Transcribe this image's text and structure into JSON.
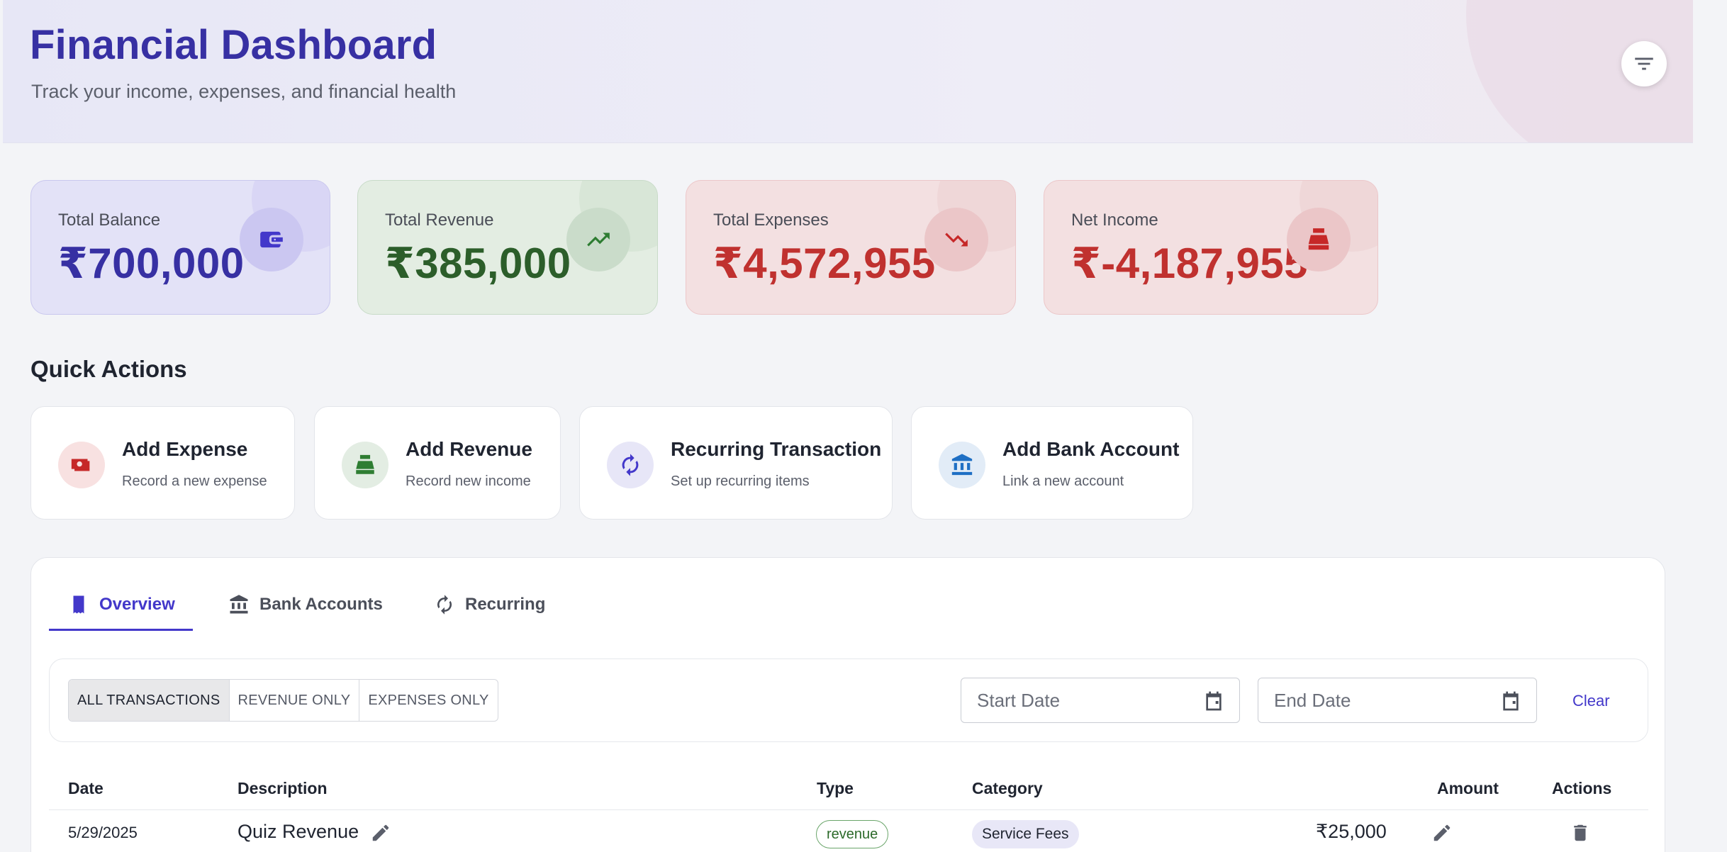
{
  "header": {
    "title": "Financial Dashboard",
    "subtitle": "Track your income, expenses, and financial health"
  },
  "stats": {
    "balance": {
      "label": "Total Balance",
      "value": "₹700,000"
    },
    "revenue": {
      "label": "Total Revenue",
      "value": "₹385,000"
    },
    "expenses": {
      "label": "Total Expenses",
      "value": "₹4,572,955"
    },
    "net": {
      "label": "Net Income",
      "value": "₹-4,187,955"
    }
  },
  "quick_actions": {
    "title": "Quick Actions",
    "items": [
      {
        "title": "Add Expense",
        "subtitle": "Record a new expense"
      },
      {
        "title": "Add Revenue",
        "subtitle": "Record new income"
      },
      {
        "title": "Recurring Transaction",
        "subtitle": "Set up recurring items"
      },
      {
        "title": "Add Bank Account",
        "subtitle": "Link a new account"
      }
    ]
  },
  "tabs": [
    {
      "label": "Overview",
      "active": true
    },
    {
      "label": "Bank Accounts",
      "active": false
    },
    {
      "label": "Recurring",
      "active": false
    }
  ],
  "filters": {
    "segments": [
      "ALL TRANSACTIONS",
      "REVENUE ONLY",
      "EXPENSES ONLY"
    ],
    "active_segment": "ALL TRANSACTIONS",
    "start_date_placeholder": "Start Date",
    "end_date_placeholder": "End Date",
    "clear_label": "Clear"
  },
  "table": {
    "columns": [
      "Date",
      "Description",
      "Type",
      "Category",
      "Amount",
      "Actions"
    ],
    "rows": [
      {
        "date": "5/29/2025",
        "description": "Quiz Revenue",
        "type": "revenue",
        "category": "Service Fees",
        "amount": "₹25,000"
      }
    ]
  },
  "colors": {
    "primary": "#3730a3",
    "revenue_green": "#2c5e2a",
    "expense_red": "#c0312f"
  }
}
